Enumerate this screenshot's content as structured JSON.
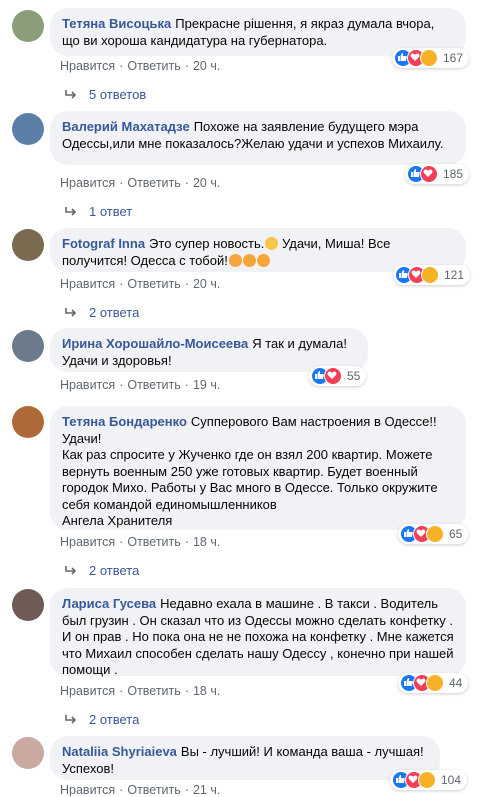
{
  "action_like": "Нравится",
  "action_reply": "Ответить",
  "comments": [
    {
      "author": "Тетяна Висоцька",
      "text": "Прекрасне рішення, я якраз думала вчора, що ви хороша кандидатура на губернатора.",
      "time": "20 ч.",
      "reactions": [
        "like",
        "love",
        "haha"
      ],
      "reaction_count": "167",
      "replies": "5 ответов",
      "avatar_color": "#8b9e7a"
    },
    {
      "author": "Валерий Махатадзе",
      "text": "Похоже на заявление будущего мэра Одессы,или мне показалось?Желаю удачи и успехов Михаилу.",
      "time": "20 ч.",
      "reactions": [
        "like",
        "love"
      ],
      "reaction_count": "185",
      "replies": "1 ответ",
      "avatar_color": "#5c7fa8"
    },
    {
      "author": "Fotograf Inna",
      "text": "Это супер новость.",
      "text2": " Удачи, Миша! Все получится! Одесса с тобой!",
      "time": "20 ч.",
      "reactions": [
        "like",
        "love",
        "haha"
      ],
      "reaction_count": "121",
      "replies": "2 ответа",
      "avatar_color": "#7a6a4f"
    },
    {
      "author": "Ирина Хорошайло-Моисеева",
      "text": "Я так и думала! Удачи и здоровья!",
      "time": "19 ч.",
      "reactions": [
        "like",
        "love"
      ],
      "reaction_count": "55",
      "replies": "",
      "avatar_color": "#6b7b8c"
    },
    {
      "author": "Тетяна Бондаренко",
      "text": "Суппеpового Вам настроения в Одессе!! Удачи!\nКак раз спросите у Жученко где он взял 200 квартир. Можете вернуть военным 250 уже готовых квартир. Будет военный городок Михо. Работы у Вас много в Одессе. Только окружите себя командой единомышленников\nАнгела Хранителя",
      "time": "18 ч.",
      "reactions": [
        "like",
        "love",
        "haha"
      ],
      "reaction_count": "65",
      "replies": "2 ответа",
      "avatar_color": "#b06a3a"
    },
    {
      "author": "Лариса Гусева",
      "text": "Недавно ехала в машине . В такси . Водитель был грузин . Он сказал что из Одессы можно сделать конфетку . И он прав . Но пока она не не похожа на конфетку . Мне кажется что Михаил способен сделать нашу Одессу , конечно при нашей помощи .",
      "time": "18 ч.",
      "reactions": [
        "like",
        "love",
        "haha"
      ],
      "reaction_count": "44",
      "replies": "2 ответа",
      "avatar_color": "#6e5b55"
    },
    {
      "author": "Nataliia Shyriaieva",
      "text": "Вы - лучший! И команда ваша - лучшая! Успехов!",
      "time": "21 ч.",
      "reactions": [
        "like",
        "love",
        "haha"
      ],
      "reaction_count": "104",
      "replies": "",
      "avatar_color": "#c9a9a0"
    }
  ]
}
